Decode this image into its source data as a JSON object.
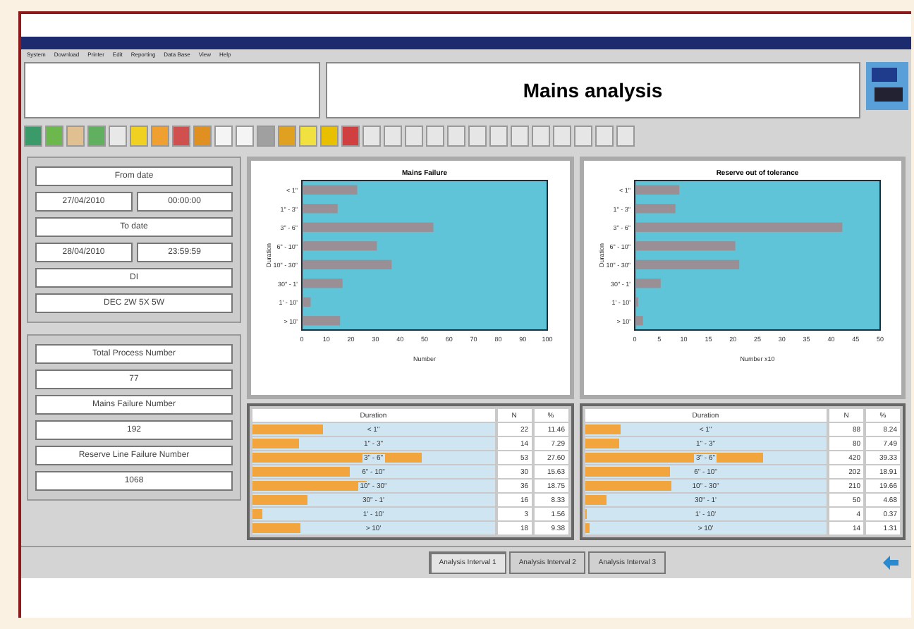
{
  "window": {
    "title": "Mains analysis"
  },
  "menu": [
    "System",
    "Download",
    "Printer",
    "Edit",
    "Reporting",
    "Data Base",
    "View",
    "Help"
  ],
  "summary": {
    "groups": [
      {
        "label": "From date",
        "values": [
          "27/04/2010",
          "00:00:00"
        ]
      },
      {
        "label": "To date",
        "values": [
          "28/04/2010",
          "23:59:59"
        ]
      },
      {
        "label": "DI",
        "values": [
          "DEC 2W 5X 5W"
        ]
      }
    ]
  },
  "counters": [
    {
      "label": "Total Process Number",
      "value": "77"
    },
    {
      "label": "Mains Failure Number",
      "value": "192"
    },
    {
      "label": "Reserve Line Failure Number",
      "value": "1068"
    }
  ],
  "panels": [
    {
      "chart_data": {
        "type": "bar",
        "orientation": "horizontal",
        "title": "Mains Failure",
        "xlabel": "Number",
        "ylabel": "Duration",
        "categories": [
          "< 1\"",
          "1\" - 3\"",
          "3\" - 6\"",
          "6\" - 10\"",
          "10\" - 30\"",
          "30\" - 1'",
          "1' - 10'",
          "> 10'"
        ],
        "series": [
          {
            "color": "#9a8f95",
            "values": [
              22,
              14,
              53,
              30,
              36,
              16,
              3,
              15
            ]
          }
        ],
        "xlim": [
          0,
          100
        ],
        "xticks": [
          0,
          10,
          20,
          30,
          40,
          50,
          60,
          70,
          80,
          90,
          100
        ]
      },
      "table": {
        "columns": [
          "Duration",
          "N",
          "%"
        ],
        "rows": [
          {
            "cells": [
              "< 1\"",
              "22",
              "11.46"
            ],
            "level": 0.29
          },
          {
            "cells": [
              "1\" - 3\"",
              "14",
              "7.29"
            ],
            "level": 0.19
          },
          {
            "cells": [
              "3\" - 6\"",
              "53",
              "27.60"
            ],
            "level": 0.7
          },
          {
            "cells": [
              "6\" - 10\"",
              "30",
              "15.63"
            ],
            "level": 0.4
          },
          {
            "cells": [
              "10\" - 30\"",
              "36",
              "18.75"
            ],
            "level": 0.47
          },
          {
            "cells": [
              "30\" - 1'",
              "16",
              "8.33"
            ],
            "level": 0.23
          },
          {
            "cells": [
              "1' - 10'",
              "3",
              "1.56"
            ],
            "level": 0.04
          },
          {
            "cells": [
              "> 10'",
              "18",
              "9.38"
            ],
            "level": 0.2
          }
        ]
      }
    },
    {
      "chart_data": {
        "type": "bar",
        "orientation": "horizontal",
        "title": "Reserve out of tolerance",
        "xlabel": "Number x10",
        "ylabel": "Duration",
        "categories": [
          "< 1\"",
          "1\" - 3\"",
          "3\" - 6\"",
          "6\" - 10\"",
          "10\" - 30\"",
          "30\" - 1'",
          "1' - 10'",
          "> 10'"
        ],
        "series": [
          {
            "color": "#9a8f95",
            "values": [
              8.8,
              8,
              42,
              20.2,
              21,
              5,
              0.4,
              1.4
            ]
          }
        ],
        "xlim": [
          0,
          50
        ],
        "xticks": [
          0,
          5,
          10,
          15,
          20,
          25,
          30,
          35,
          40,
          45,
          50
        ]
      },
      "table": {
        "columns": [
          "Duration",
          "N",
          "%"
        ],
        "rows": [
          {
            "cells": [
              "< 1\"",
              "88",
              "8.24"
            ],
            "level": 0.15
          },
          {
            "cells": [
              "1\" - 3\"",
              "80",
              "7.49"
            ],
            "level": 0.14
          },
          {
            "cells": [
              "3\" - 6\"",
              "420",
              "39.33"
            ],
            "level": 0.74
          },
          {
            "cells": [
              "6\" - 10\"",
              "202",
              "18.91"
            ],
            "level": 0.35
          },
          {
            "cells": [
              "10\" - 30\"",
              "210",
              "19.66"
            ],
            "level": 0.36
          },
          {
            "cells": [
              "30\" - 1'",
              "50",
              "4.68"
            ],
            "level": 0.09
          },
          {
            "cells": [
              "1' - 10'",
              "4",
              "0.37"
            ],
            "level": 0.01
          },
          {
            "cells": [
              "> 10'",
              "14",
              "1.31"
            ],
            "level": 0.02
          }
        ]
      }
    }
  ],
  "tabs": [
    {
      "label": "Analysis Interval 1",
      "selected": true
    },
    {
      "label": "Analysis Interval 2",
      "selected": false
    },
    {
      "label": "Analysis Interval 3",
      "selected": false
    }
  ]
}
